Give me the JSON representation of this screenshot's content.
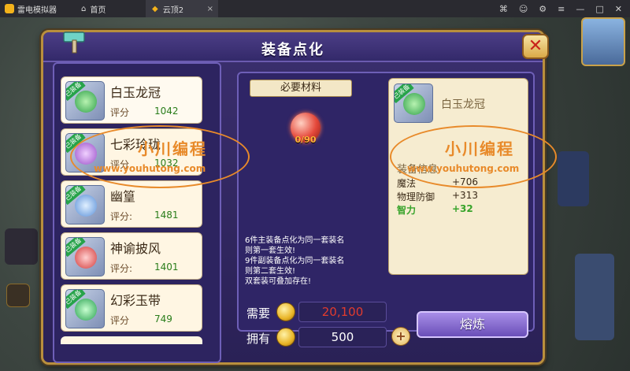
{
  "emulator": {
    "app_name": "雷电模拟器",
    "home_tab": "首页",
    "active_tab": "云顶2",
    "tab_close": "×"
  },
  "panel": {
    "title": "装备点化",
    "close_glyph": "✕"
  },
  "items": [
    {
      "name": "白玉龙冠",
      "score_label": "评分",
      "score": "1042",
      "equipped": "已装备",
      "art": "green-crown"
    },
    {
      "name": "七彩玲珑",
      "score_label": "评分",
      "score": "1032",
      "equipped": "已装备",
      "art": "purple-necklace"
    },
    {
      "name": "幽篁",
      "score_label": "评分:",
      "score": "1481",
      "equipped": "已装备",
      "art": "blue-flower"
    },
    {
      "name": "神谕披风",
      "score_label": "评分:",
      "score": "1401",
      "equipped": "已装备",
      "art": "red-cape"
    },
    {
      "name": "幻彩玉带",
      "score_label": "评分",
      "score": "749",
      "equipped": "已装备",
      "art": "green-belt"
    }
  ],
  "materials": {
    "label": "必要材料",
    "count": "0/90",
    "art": "red-gem-icon"
  },
  "description": [
    "6件主装备点化为同一套装名",
    "则第一套生效!",
    "9件副装备点化为同一套装名",
    "则第二套生效!",
    "双套装可叠加存在!"
  ],
  "preview": {
    "name": "白玉龙冠",
    "attr_heading": "装备信息",
    "attrs": [
      {
        "name": "魔法",
        "value": "+706"
      },
      {
        "name": "物理防御",
        "value": "+313"
      },
      {
        "name": "智力",
        "value": "+32"
      }
    ]
  },
  "cost": {
    "need_label": "需要",
    "need_value": "20,100",
    "have_label": "拥有",
    "have_value": "500",
    "plus_glyph": "+"
  },
  "forge_label": "熔炼",
  "watermark": {
    "text": "小川编程",
    "url": "www.youhutong.com"
  },
  "colors": {
    "panel": "#2a2156",
    "border_gold": "#b98f3d",
    "score_green": "#2a7d1a",
    "need_red": "#e23b2e",
    "watermark": "#e88a2a"
  }
}
